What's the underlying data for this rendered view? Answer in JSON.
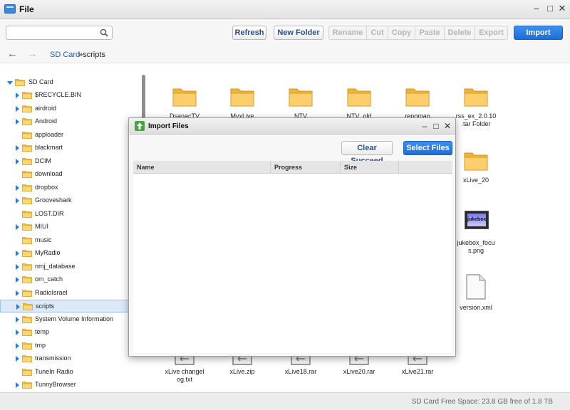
{
  "window": {
    "title": "File"
  },
  "toolbar": {
    "search_placeholder": "",
    "refresh": "Refresh",
    "new_folder": "New Folder",
    "rename": "Rename",
    "cut": "Cut",
    "copy": "Copy",
    "paste": "Paste",
    "delete": "Delete",
    "export": "Export",
    "import": "Import"
  },
  "breadcrumb": {
    "root": "SD Card",
    "current": "»scripts"
  },
  "tree": {
    "root": "SD Card",
    "items": [
      {
        "label": "$RECYCLE.BIN",
        "expandable": true
      },
      {
        "label": "airdroid",
        "expandable": true
      },
      {
        "label": "Android",
        "expandable": true
      },
      {
        "label": "apploader",
        "expandable": false
      },
      {
        "label": "blackmart",
        "expandable": true
      },
      {
        "label": "DCIM",
        "expandable": true
      },
      {
        "label": "download",
        "expandable": false
      },
      {
        "label": "dropbox",
        "expandable": true
      },
      {
        "label": "Grooveshark",
        "expandable": true
      },
      {
        "label": "LOST.DIR",
        "expandable": false
      },
      {
        "label": "MIUI",
        "expandable": true
      },
      {
        "label": "music",
        "expandable": false
      },
      {
        "label": "MyRadio",
        "expandable": true
      },
      {
        "label": "nmj_database",
        "expandable": true
      },
      {
        "label": "om_catch",
        "expandable": true
      },
      {
        "label": "RadioIsrael",
        "expandable": true
      },
      {
        "label": "scripts",
        "expandable": true,
        "selected": true
      },
      {
        "label": "System Volume Information",
        "expandable": true
      },
      {
        "label": "temp",
        "expandable": true
      },
      {
        "label": "tmp",
        "expandable": true
      },
      {
        "label": "transmission",
        "expandable": true
      },
      {
        "label": "TuneIn Radio",
        "expandable": false
      },
      {
        "label": "TunnyBrowser",
        "expandable": true
      }
    ]
  },
  "files": {
    "row1": [
      "DsanacTV",
      "MyxLive",
      "NTV",
      "NTV_old",
      "repomap",
      "rss_ex_2.0.10\n.tar Folder"
    ],
    "right_col": [
      "xLive_20",
      "jukebox_focu\ns.png",
      "version.xml"
    ],
    "bottom": [
      "xLive changel\nog.txt",
      "xLive.zip",
      "xLive18.rar",
      "xLive20.rar",
      "xLive21.rar"
    ],
    "thumb_text": "jukebox"
  },
  "status": {
    "text": "SD Card Free Space: 23.8 GB free of 1.8 TB"
  },
  "dialog": {
    "title": "Import Files",
    "clear_succeed": "Clear Succeed",
    "select_files": "Select Files",
    "columns": [
      "Name",
      "Progress",
      "Size"
    ]
  },
  "colors": {
    "accent": "#1f6fd8",
    "folder": "#f5c04f",
    "selection": "#dbe9f8"
  }
}
